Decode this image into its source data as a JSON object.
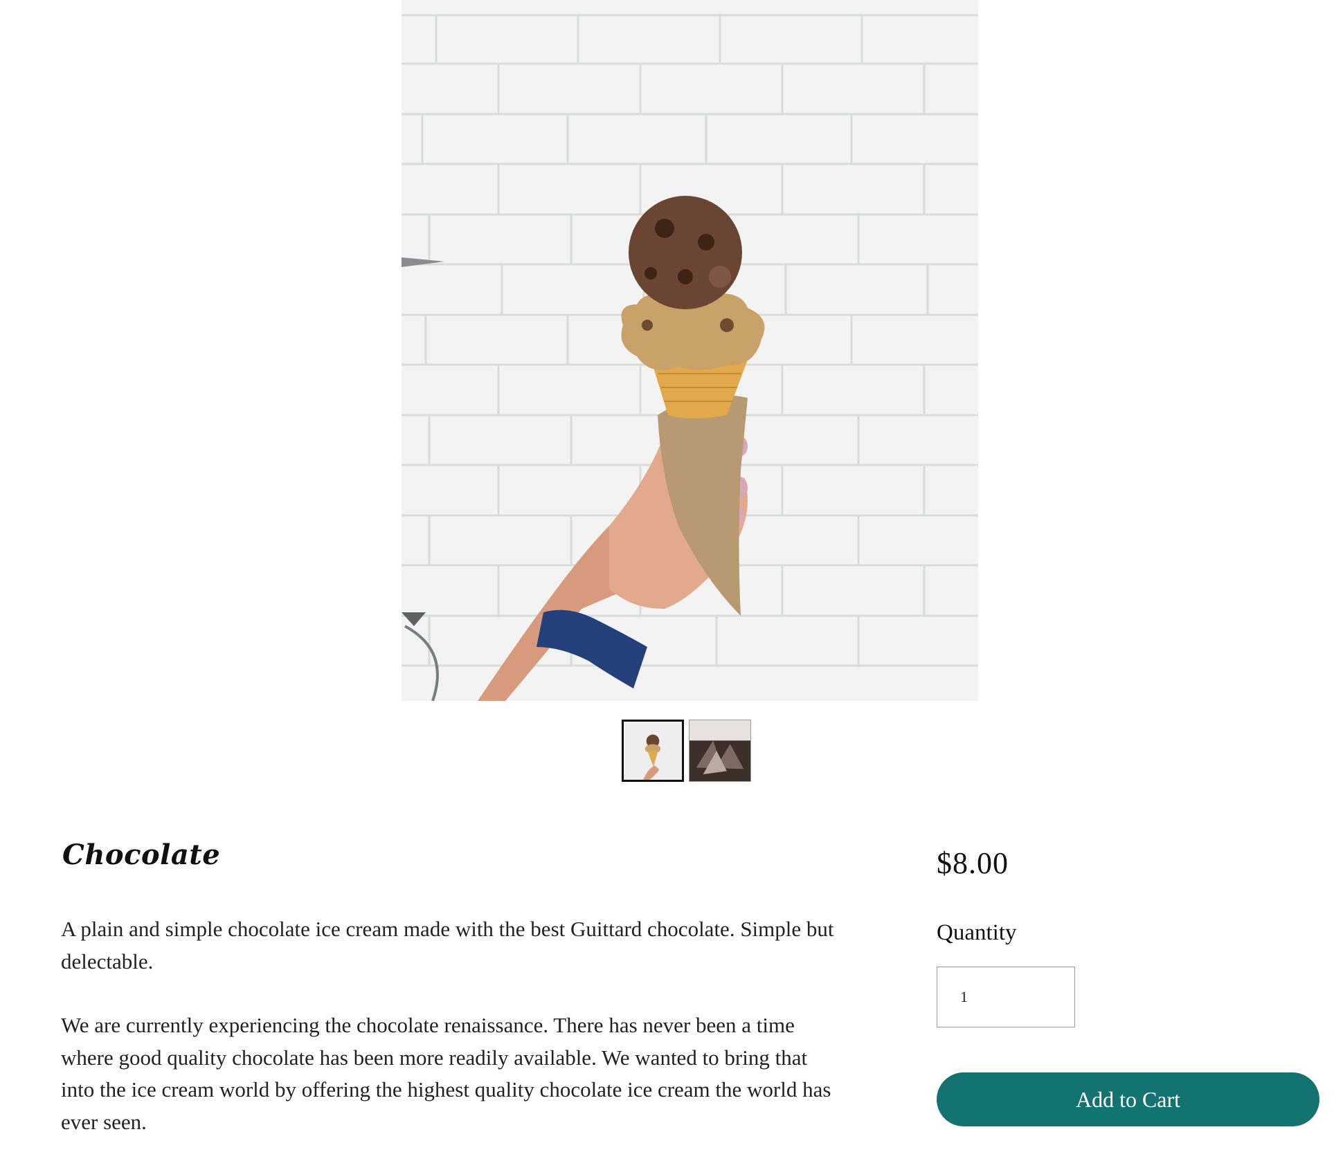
{
  "product": {
    "title": "Chocolate",
    "description": [
      "A plain and simple chocolate ice cream made with the best Guittard chocolate. Simple but delectable.",
      "We are currently experiencing the chocolate renaissance. There has never been a time where good quality chocolate has been more readily available. We wanted to bring that into the ice cream world by offering the highest quality chocolate ice cream the world has ever seen."
    ],
    "price": "$8.00",
    "quantity_label": "Quantity",
    "quantity_value": "1",
    "add_to_cart_label": "Add to Cart"
  },
  "gallery": {
    "selected_index": 0,
    "thumbnail_count": 2
  },
  "colors": {
    "accent": "#137370",
    "text": "#111111"
  }
}
